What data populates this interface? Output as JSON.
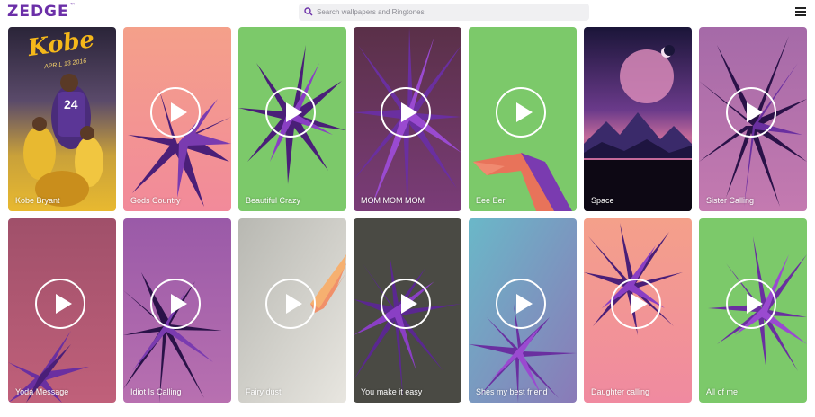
{
  "header": {
    "logo": "ZEDGE",
    "logo_mark": "™",
    "search_placeholder": "Search wallpapers and Ringtones",
    "search_icon": "search-icon",
    "menu_icon": "hamburger-menu-icon"
  },
  "colors": {
    "brand": "#6b2fa8",
    "search_bg": "#f0f0f2"
  },
  "tiles": [
    {
      "label": "Kobe Bryant",
      "type": "wallpaper"
    },
    {
      "label": "Gods Country",
      "type": "ringtone"
    },
    {
      "label": "Beautiful Crazy",
      "type": "ringtone"
    },
    {
      "label": "MOM MOM MOM",
      "type": "ringtone"
    },
    {
      "label": "Eee Eer",
      "type": "ringtone"
    },
    {
      "label": "Space",
      "type": "wallpaper"
    },
    {
      "label": "Sister Calling",
      "type": "ringtone"
    },
    {
      "label": "Yoda Message",
      "type": "ringtone"
    },
    {
      "label": "Idiot Is Calling",
      "type": "ringtone"
    },
    {
      "label": "Fairy dust",
      "type": "ringtone"
    },
    {
      "label": "You make it easy",
      "type": "ringtone"
    },
    {
      "label": "Shes my best friend",
      "type": "ringtone"
    },
    {
      "label": "Daughter calling",
      "type": "ringtone"
    },
    {
      "label": "All of me",
      "type": "ringtone"
    }
  ],
  "kobe_art": {
    "title": "Kobe",
    "subtitle": "APRIL 13 2016",
    "jersey": "24"
  }
}
